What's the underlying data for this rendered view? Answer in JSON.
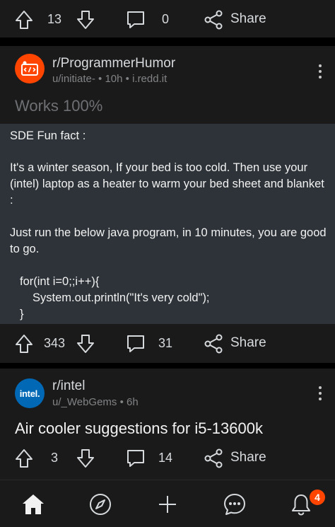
{
  "colors": {
    "background": "#000000",
    "card": "#1a1a1b",
    "image_block": "#2d3338",
    "accent": "#ff4500",
    "intel_blue": "#0068b5",
    "muted": "#818384"
  },
  "top_bar": {
    "upvotes": "13",
    "comments": "0",
    "share_label": "Share"
  },
  "post1": {
    "subreddit": "r/ProgrammerHumor",
    "meta": "u/initiate- • 10h • i.redd.it",
    "title": "Works 100%",
    "body_lines": [
      "SDE Fun fact :",
      "It's a winter season, If your bed is too cold. Then use your (intel) laptop as a heater to warm your bed sheet and blanket :",
      "Just run the below java program, in 10 minutes, you are good to go.",
      "for(int i=0;;i++){",
      "System.out.println(\"It's very cold\");",
      "}"
    ],
    "upvotes": "343",
    "comments": "31",
    "share_label": "Share"
  },
  "post2": {
    "subreddit": "r/intel",
    "avatar_text": "intel.",
    "meta": "u/_WebGems • 6h",
    "title": "Air cooler suggestions for i5-13600k",
    "upvotes": "3",
    "comments": "14",
    "share_label": "Share"
  },
  "nav": {
    "items": [
      "home-icon",
      "explore-icon",
      "create-icon",
      "chat-icon",
      "inbox-icon"
    ],
    "inbox_badge": "4"
  }
}
